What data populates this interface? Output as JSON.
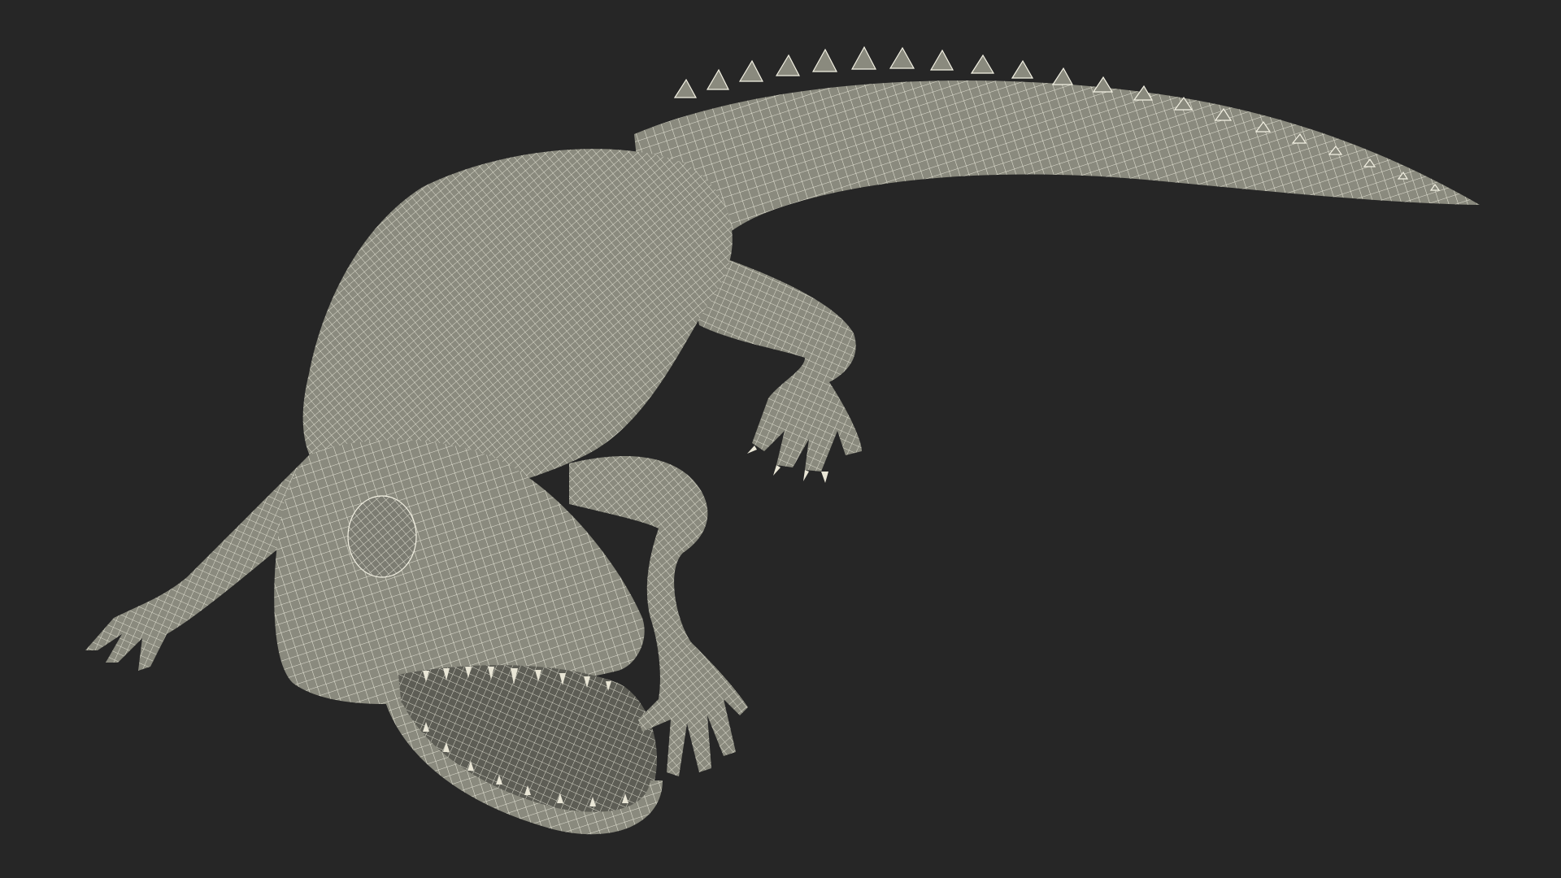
{
  "scene": {
    "subject_icon": "alligator-wireframe-icon",
    "colors": {
      "background": "#262626",
      "surface": "#8a8a7e",
      "surface_dark": "#6f6f65",
      "wire": "#f4f2e4",
      "teeth": "#e9e6d6",
      "mouth_interior": "#5d5d55"
    }
  }
}
